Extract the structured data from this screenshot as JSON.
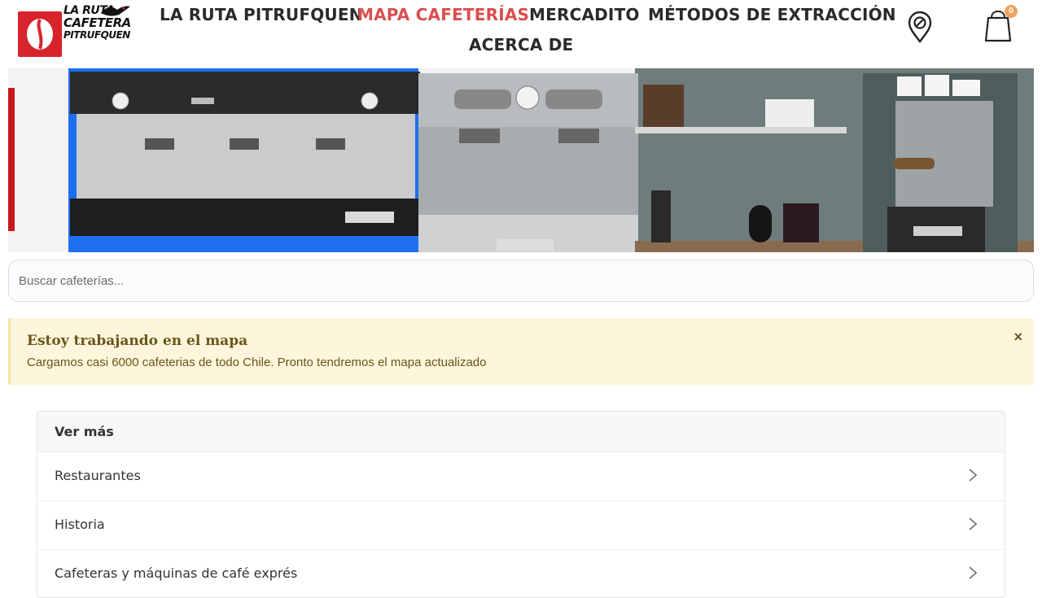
{
  "header": {
    "logo": {
      "name": "La Ruta Cafetera Pitrufquen",
      "line1": "LA RUTA",
      "line2": "CAFETERA",
      "line3": "PITRUFQUEN"
    },
    "nav": [
      {
        "label": "LA RUTA PITRUFQUEN",
        "active": false
      },
      {
        "label": "MAPA CAFETERÍAS",
        "active": true
      },
      {
        "label": "MERCADITO",
        "active": false
      },
      {
        "label": "MÉTODOS DE EXTRACCIÓN",
        "active": false
      },
      {
        "label": "ACERCA DE",
        "active": false
      }
    ],
    "icons": {
      "location": "map-pin-icon",
      "cart": "shopping-bag-icon"
    },
    "cart_count": "0"
  },
  "banner": {
    "description_items": [
      "espresso-machine-three-group",
      "espresso-machine-two-group",
      "kitchen-shelf",
      "lever-espresso-machine"
    ],
    "brand_labels": [
      "La Rocca",
      "La Rocca",
      "La Rocca"
    ]
  },
  "search": {
    "placeholder": "Buscar cafeterías...",
    "value": ""
  },
  "alert": {
    "title": "Estoy trabajando en el mapa",
    "text": "Cargamos casi 6000 cafeterias de todo Chile. Pronto tendremos el mapa actualizado",
    "close": "×"
  },
  "more": {
    "header": "Ver más",
    "items": [
      {
        "label": "Restaurantes"
      },
      {
        "label": "Historia"
      },
      {
        "label": "Cafeteras y máquinas de café exprés"
      }
    ]
  },
  "colors": {
    "accent_red": "#d94f4f",
    "logo_red": "#d8232a",
    "cart_badge": "#f0a35e",
    "alert_bg": "#fdf6dc",
    "alert_text": "#6b5419",
    "banner_blue": "#1e6ff0"
  }
}
